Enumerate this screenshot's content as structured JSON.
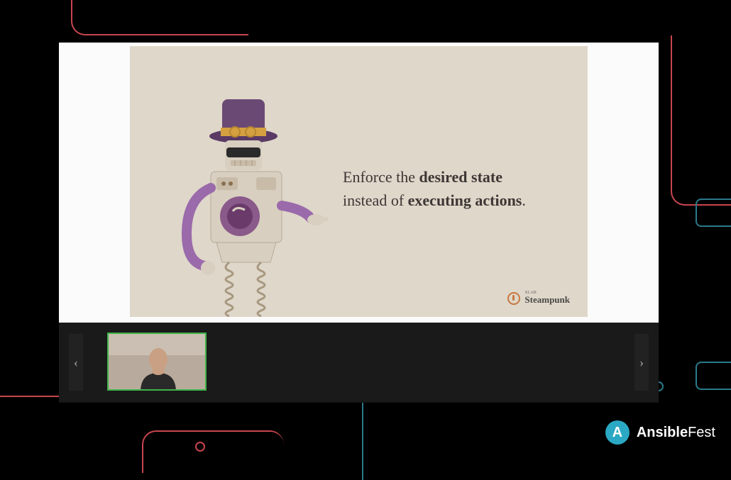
{
  "slide": {
    "text_prefix": "Enforce the ",
    "text_bold1": "desired state",
    "text_mid": " instead of ",
    "text_bold2": "executing actions",
    "text_suffix": "."
  },
  "steampunk": {
    "small": "XLAB",
    "name": "Steampunk"
  },
  "ansible": {
    "letter": "A",
    "brand_bold": "Ansible",
    "brand_light": "Fest"
  },
  "nav": {
    "prev": "‹",
    "next": "›"
  }
}
